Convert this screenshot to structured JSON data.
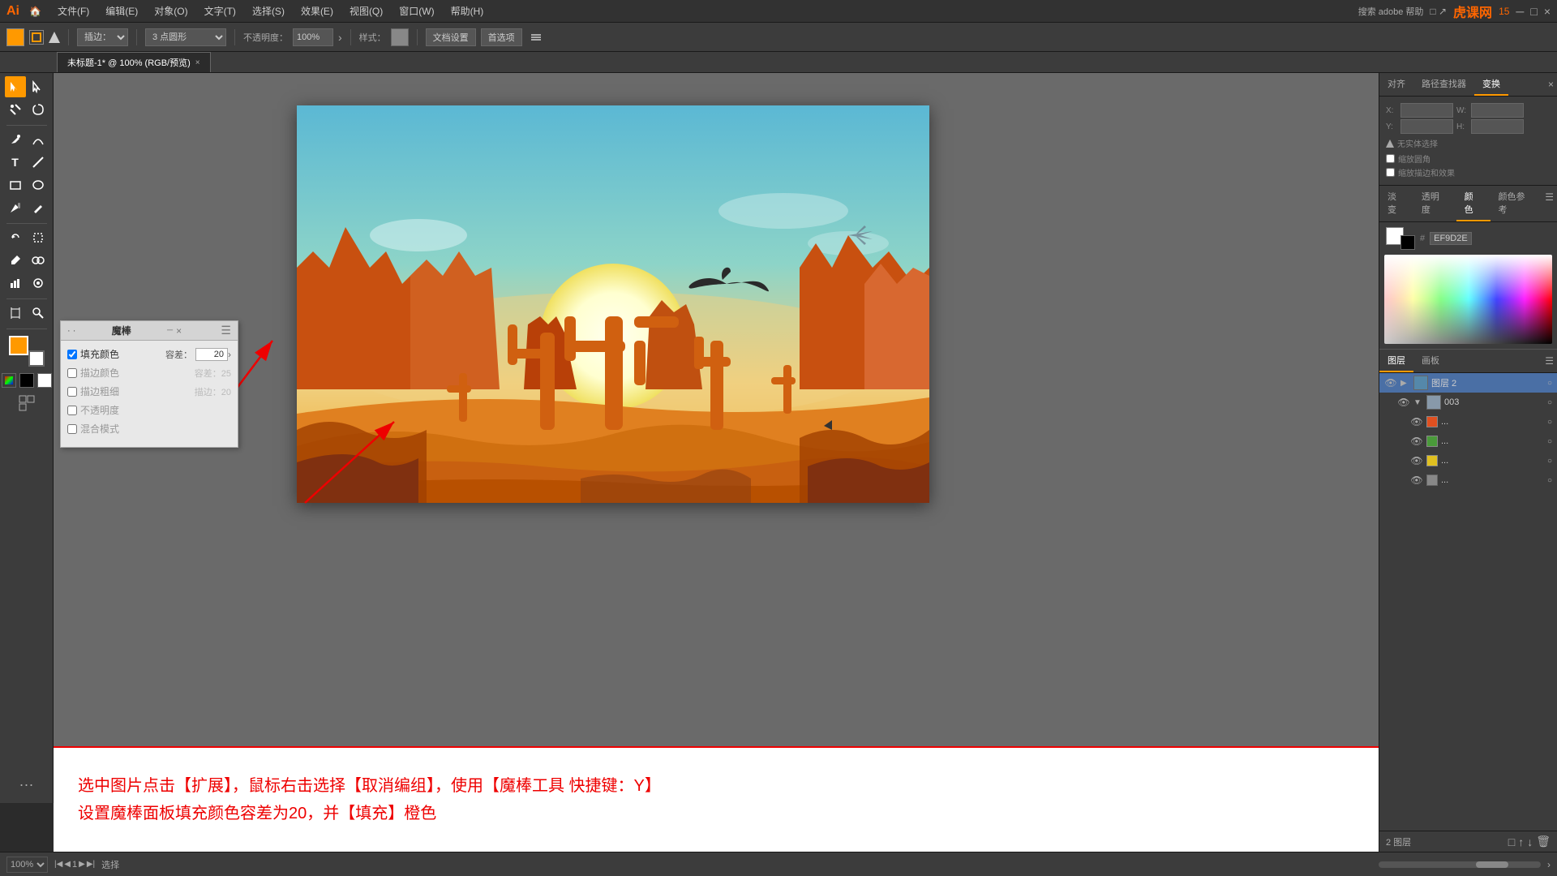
{
  "app": {
    "logo": "Ai",
    "watermark": "虎课网",
    "watermark_sub": "15"
  },
  "menubar": {
    "items": [
      "文件(F)",
      "编辑(E)",
      "对象(O)",
      "文字(T)",
      "选择(S)",
      "效果(E)",
      "视图(Q)",
      "窗口(W)",
      "帮助(H)"
    ]
  },
  "toolbar": {
    "fill_label": "填充颜色",
    "stroke_label": "描边：",
    "blend_label": "插边：",
    "points_label": "3  点圆形",
    "opacity_label": "不透明度：",
    "opacity_value": "100%",
    "style_label": "样式：",
    "doc_settings": "文档设置",
    "preferences": "首选项"
  },
  "tab": {
    "title": "未标题-1* @ 100% (RGB/预览)",
    "close": "×"
  },
  "magic_panel": {
    "title": "魔棒",
    "fill_color": "填充颜色",
    "tolerance_label": "容差：",
    "tolerance_value": "20",
    "stroke_color": "描边颜色",
    "stroke_tolerance": "容差：25",
    "stroke_weight": "描边粗细",
    "stroke_weight_val": "描边：20",
    "opacity": "不透明度",
    "blend_mode": "混合模式"
  },
  "right_panel": {
    "tabs": [
      "对齐",
      "路径查找器",
      "变换"
    ],
    "active_tab": "变换",
    "no_selection": "无实体选择",
    "transform": {
      "x_label": "X",
      "y_label": "Y",
      "w_label": "W",
      "h_label": "H"
    },
    "color_tabs": [
      "淡变",
      "透明度",
      "颜色",
      "颜色参考"
    ],
    "active_color_tab": "颜色",
    "hex_label": "#",
    "hex_value": "EF9D2E"
  },
  "layers_panel": {
    "tabs": [
      "图层",
      "画板"
    ],
    "active_tab": "图层",
    "items": [
      {
        "name": "图层 2",
        "visible": true,
        "selected": true,
        "expanded": true,
        "indent": 0,
        "type": "group"
      },
      {
        "name": "003",
        "visible": true,
        "selected": false,
        "expanded": false,
        "indent": 1,
        "type": "item"
      },
      {
        "name": "...",
        "visible": true,
        "selected": false,
        "indent": 2,
        "color": "#e05020",
        "type": "color"
      },
      {
        "name": "...",
        "visible": true,
        "selected": false,
        "indent": 2,
        "color": "#4a9a3a",
        "type": "color"
      },
      {
        "name": "...",
        "visible": true,
        "selected": false,
        "indent": 2,
        "color": "#e0c020",
        "type": "color"
      },
      {
        "name": "...",
        "visible": true,
        "selected": false,
        "indent": 2,
        "color": "#888",
        "type": "color"
      }
    ],
    "footer_label": "2 图层"
  },
  "status_bar": {
    "zoom": "100%",
    "page_label": "1",
    "action": "选择"
  },
  "instruction": {
    "line1": "选中图片点击【扩展】，鼠标右击选择【取消编组】，使用【魔棒工具 快捷键：Y】",
    "line2": "设置魔棒面板填充颜色容差为20，并【填充】橙色"
  },
  "arrows": {
    "note": "Red arrows pointing from magic panel to canvas"
  }
}
